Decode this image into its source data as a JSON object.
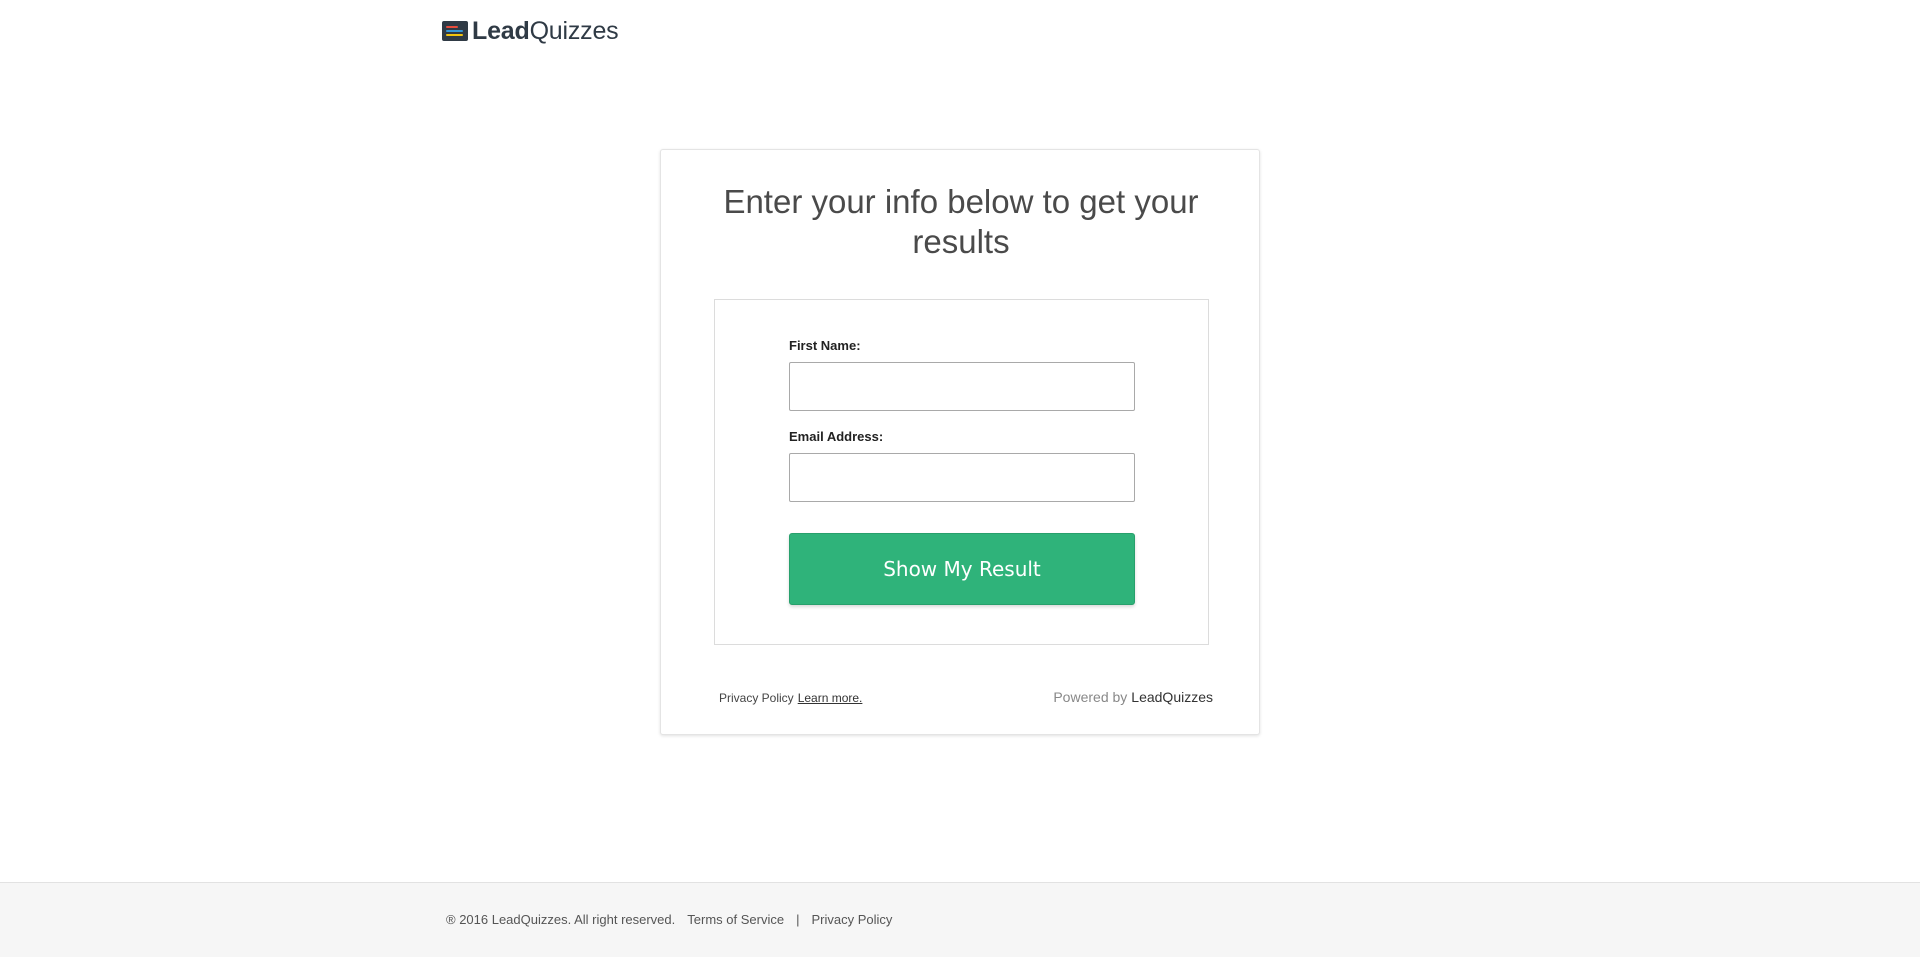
{
  "header": {
    "logo_lead": "Lead",
    "logo_quizzes": "Quizzes",
    "logo_icon": "quiz-stack-icon",
    "logo_bar_colors": [
      "#e74c3c",
      "#3498db",
      "#f1c40f"
    ]
  },
  "card": {
    "title": "Enter your info below to get your results",
    "form": {
      "first_name_label": "First Name:",
      "first_name_value": "",
      "email_label": "Email Address:",
      "email_value": "",
      "submit_label": "Show My Result"
    },
    "footer": {
      "privacy_text": "Privacy Policy",
      "learn_more": "Learn more.",
      "powered_by": "Powered by",
      "powered_brand": "LeadQuizzes"
    }
  },
  "site_footer": {
    "copyright": "® 2016 LeadQuizzes. All right reserved.",
    "terms": "Terms of Service",
    "separator": "|",
    "privacy": "Privacy Policy"
  },
  "colors": {
    "accent": "#2fb37a",
    "text_dark": "#2f3a45",
    "footer_bg": "#f6f6f6"
  }
}
